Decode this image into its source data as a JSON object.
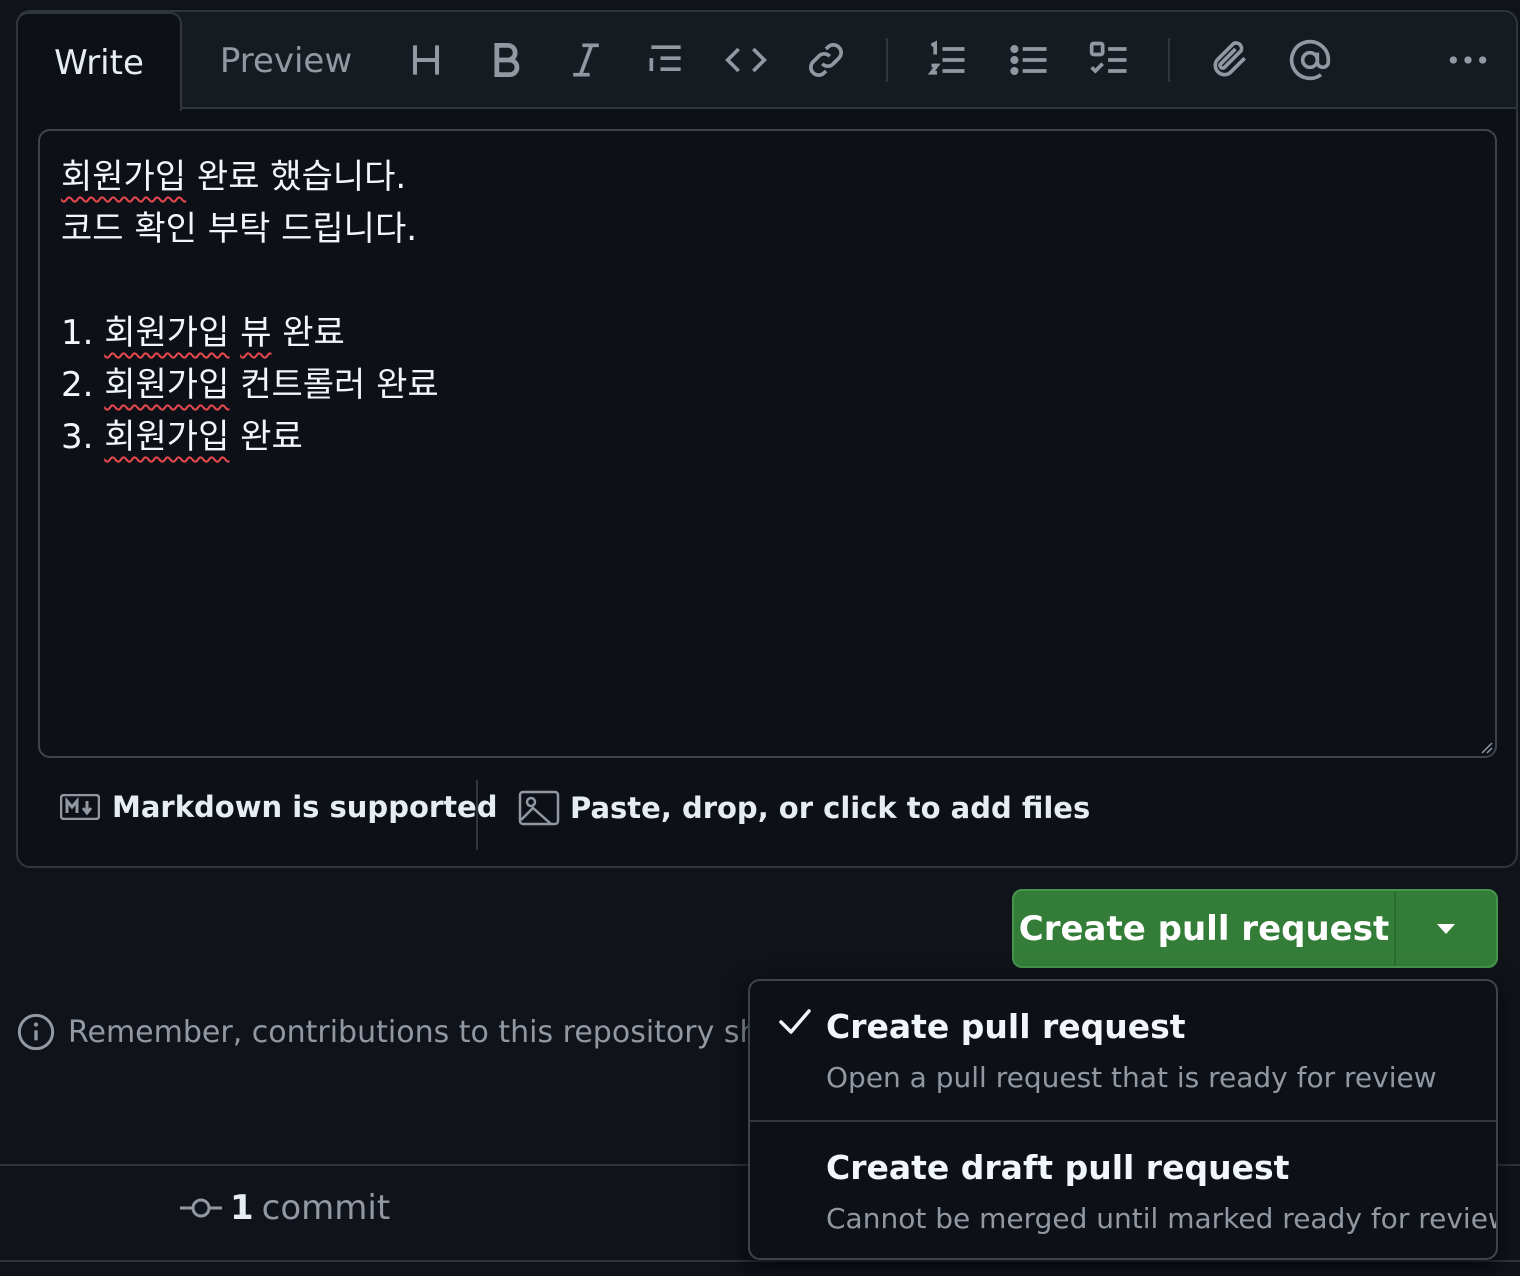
{
  "tabs": {
    "write": "Write",
    "preview": "Preview"
  },
  "toolbar": [
    "heading-icon",
    "bold-icon",
    "italic-icon",
    "quote-icon",
    "code-icon",
    "link-icon",
    "ordered-list-icon",
    "unordered-list-icon",
    "task-list-icon",
    "attach-icon",
    "mention-icon",
    "more-icon"
  ],
  "editor": {
    "lines": [
      "회원가입 완료 했습니다.",
      "코드 확인 부탁 드립니다.",
      "",
      "1. 회원가입 뷰 완료",
      "2. 회원가입 컨트롤러 완료",
      "3. 회원가입 완료"
    ]
  },
  "footer": {
    "markdown": "Markdown is supported",
    "files": "Paste, drop, or click to add files"
  },
  "create_button": {
    "label": "Create pull request"
  },
  "notice": "Remember, contributions to this repository should f",
  "commits": {
    "count": "1",
    "label": "commit"
  },
  "dropdown": {
    "items": [
      {
        "title": "Create pull request",
        "desc": "Open a pull request that is ready for review",
        "selected": true
      },
      {
        "title": "Create draft pull request",
        "desc": "Cannot be merged until marked ready for review",
        "selected": false
      }
    ]
  },
  "colors": {
    "accent_green": "#347d39",
    "background": "#0d1117",
    "border": "#30363d"
  }
}
